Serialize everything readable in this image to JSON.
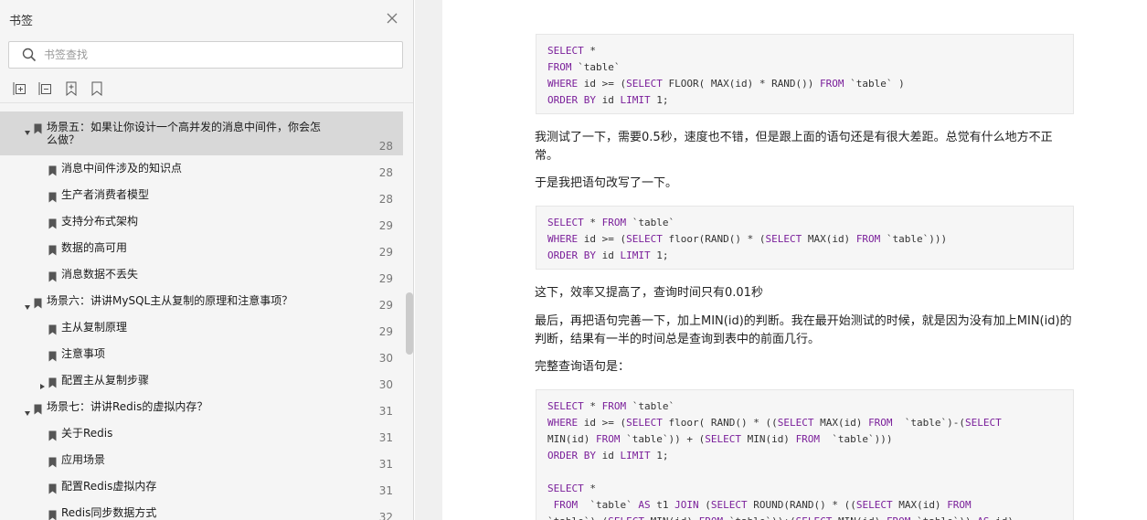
{
  "sidebar": {
    "title": "书签",
    "search_placeholder": "书签查找",
    "tree": [
      {
        "label": "场景五：如果让你设计一个高并发的消息中间件，你会怎么做？",
        "page": "28"
      },
      {
        "label": "消息中间件涉及的知识点",
        "page": "28"
      },
      {
        "label": "生产者消费者模型",
        "page": "28"
      },
      {
        "label": "支持分布式架构",
        "page": "29"
      },
      {
        "label": "数据的高可用",
        "page": "29"
      },
      {
        "label": "消息数据不丢失",
        "page": "29"
      },
      {
        "label": "场景六：讲讲MySQL主从复制的原理和注意事项？",
        "page": "29"
      },
      {
        "label": "主从复制原理",
        "page": "29"
      },
      {
        "label": "注意事项",
        "page": "30"
      },
      {
        "label": "配置主从复制步骤",
        "page": "30"
      },
      {
        "label": "场景七：讲讲Redis的虚拟内存？",
        "page": "31"
      },
      {
        "label": "关于Redis",
        "page": "31"
      },
      {
        "label": "应用场景",
        "page": "31"
      },
      {
        "label": "配置Redis虚拟内存",
        "page": "31"
      },
      {
        "label": "Redis同步数据方式",
        "page": "32"
      }
    ]
  },
  "content": {
    "code1": [
      "SELECT *",
      "FROM `table`",
      "WHERE id >= (SELECT FLOOR( MAX(id) * RAND()) FROM `table` )",
      "ORDER BY id LIMIT 1;"
    ],
    "para1": "我测试了一下，需要0.5秒，速度也不错，但是跟上面的语句还是有很大差距。总觉有什么地方不正常。",
    "para2": "于是我把语句改写了一下。",
    "code2": [
      "SELECT * FROM `table`",
      "WHERE id >= (SELECT floor(RAND() * (SELECT MAX(id) FROM `table`)))",
      "ORDER BY id LIMIT 1;"
    ],
    "para3": "这下，效率又提高了，查询时间只有0.01秒",
    "para4": "最后，再把语句完善一下，加上MIN(id)的判断。我在最开始测试的时候，就是因为没有加上MIN(id)的判断，结果有一半的时间总是查询到表中的前面几行。",
    "para5": "完整查询语句是：",
    "code3": [
      "SELECT * FROM `table`",
      "WHERE id >= (SELECT floor( RAND() * ((SELECT MAX(id) FROM  `table`)-(SELECT",
      "MIN(id) FROM `table`)) + (SELECT MIN(id) FROM  `table`)))",
      "ORDER BY id LIMIT 1;",
      "",
      "SELECT *",
      " FROM  `table` AS t1 JOIN (SELECT ROUND(RAND() * ((SELECT MAX(id) FROM",
      "`table`)-(SELECT MIN(id) FROM `table`))+(SELECT MIN(id) FROM `table`)) AS id)"
    ]
  },
  "colors": {
    "sql_keyword": "#7a1f9a",
    "selected_row": "#d8d8d8",
    "sidebar_bg": "#f5f5f5"
  }
}
